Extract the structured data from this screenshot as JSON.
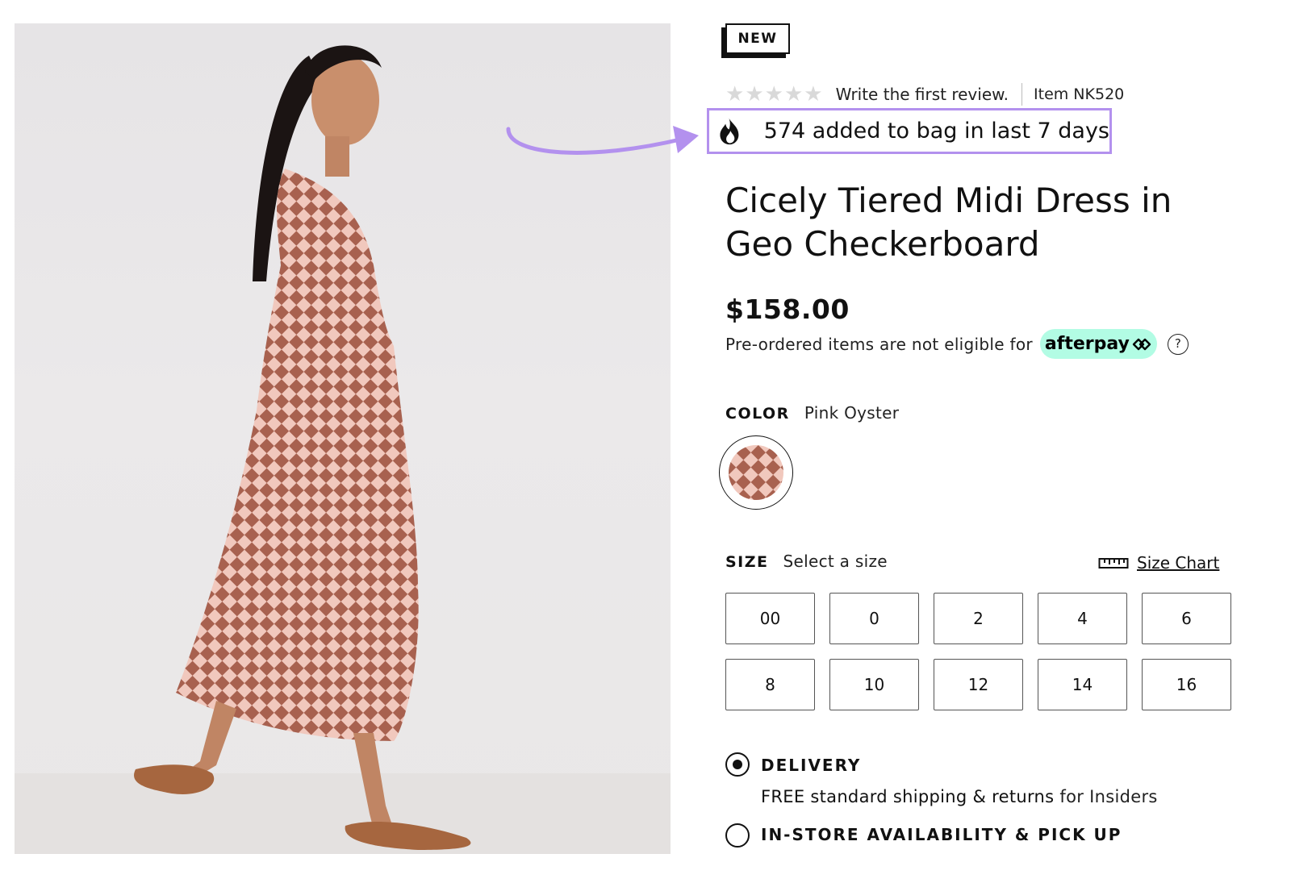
{
  "badge": {
    "label": "NEW"
  },
  "rating": {
    "stars_filled": 0,
    "stars_total": 5,
    "review_prompt": "Write the first review.",
    "item_number": "Item NK520"
  },
  "social_proof": {
    "text": "574 added to bag in last 7 days"
  },
  "product": {
    "title_line1": "Cicely Tiered Midi Dress in",
    "title_line2": "Geo Checkerboard",
    "price": "$158.00",
    "afterpay_note": "Pre-ordered items are not eligible for",
    "afterpay_brand": "afterpay",
    "help_symbol": "?"
  },
  "color": {
    "label": "COLOR",
    "value": "Pink Oyster"
  },
  "size": {
    "label": "SIZE",
    "prompt": "Select a size",
    "chart_link": "Size Chart",
    "options": [
      "00",
      "0",
      "2",
      "4",
      "6",
      "8",
      "10",
      "12",
      "14",
      "16"
    ]
  },
  "fulfillment": {
    "delivery_label": "DELIVERY",
    "delivery_detail_free": "FREE standard shipping & returns",
    "delivery_detail_rest": "for Insiders",
    "delivery_selected": true,
    "pickup_label": "IN-STORE AVAILABILITY & PICK UP",
    "pickup_selected": false
  },
  "colors": {
    "highlight": "#b391ee",
    "afterpay_mint": "#b2fce4",
    "dress_pink": "#f1c8bd",
    "dress_brown": "#a8614f"
  },
  "icons": [
    "star-icon",
    "flame-icon",
    "help-icon",
    "ruler-icon",
    "arrow-annotation"
  ]
}
